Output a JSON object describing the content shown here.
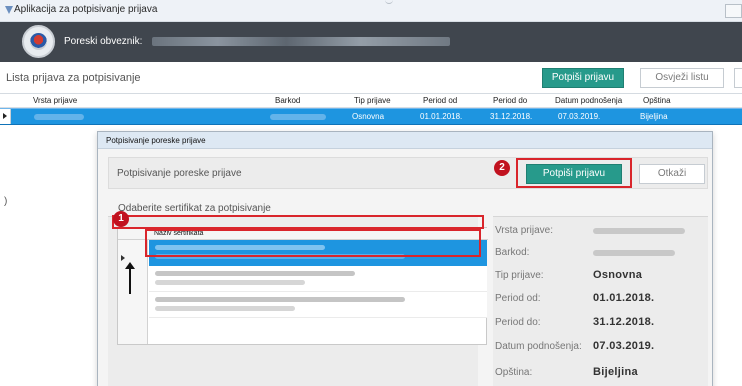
{
  "window": {
    "title": "Aplikacija za potpisivanje prijava"
  },
  "header": {
    "taxpayer_label": "Poreski obveznik:",
    "taxpayer_value_redacted": true
  },
  "toolbar": {
    "list_title": "Lista prijava za potpisivanje",
    "sign_button": "Potpiši prijavu",
    "refresh_button": "Osvježi listu"
  },
  "grid": {
    "columns": [
      "Vrsta prijave",
      "Barkod",
      "Tip prijave",
      "Period od",
      "Period do",
      "Datum podnošenja",
      "Opština"
    ],
    "rows": [
      {
        "vrsta": "",
        "barkod": "",
        "tip": "Osnovna",
        "period_od": "01.01.2018.",
        "period_do": "31.12.2018.",
        "datum": "07.03.2019.",
        "opstina": "Bijeljina",
        "selected": true
      }
    ]
  },
  "dialog": {
    "title": "Potpisivanje poreske prijave",
    "header_text": "Potpisivanje poreske prijave",
    "sign_button": "Potpiši prijavu",
    "cancel_button": "Otkaži",
    "select_cert_label": "Odaberite sertifikat za potpisivanje",
    "cert_column": "Naziv sertifikata",
    "details": [
      {
        "label": "Vrsta prijave:",
        "value": ""
      },
      {
        "label": "Barkod:",
        "value": ""
      },
      {
        "label": "Tip prijave:",
        "value": "Osnovna"
      },
      {
        "label": "Period od:",
        "value": "01.01.2018."
      },
      {
        "label": "Period do:",
        "value": "31.12.2018."
      },
      {
        "label": "Datum podnošenja:",
        "value": "07.03.2019."
      },
      {
        "label": "Opština:",
        "value": "Bijeljina"
      }
    ]
  },
  "annotations": {
    "step1": "1",
    "step2": "2",
    "highlight_color": "#d9252b"
  },
  "colors": {
    "accent_green": "#279a8b",
    "selection_blue": "#1e95e0",
    "header_dark": "#40464e"
  }
}
